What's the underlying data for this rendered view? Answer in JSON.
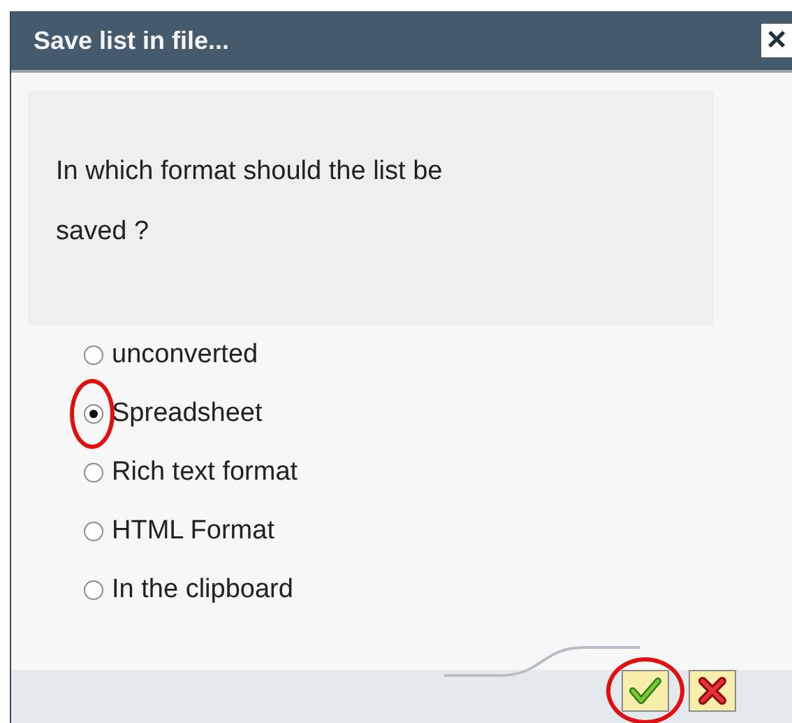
{
  "window": {
    "title": "Save list in file...",
    "close": "×"
  },
  "question": "In which format should the list be saved ?",
  "options": [
    {
      "label": "unconverted",
      "selected": false,
      "highlighted": false
    },
    {
      "label": "Spreadsheet",
      "selected": true,
      "highlighted": true
    },
    {
      "label": "Rich text format",
      "selected": false,
      "highlighted": false
    },
    {
      "label": "HTML Format",
      "selected": false,
      "highlighted": false
    },
    {
      "label": "In the clipboard",
      "selected": false,
      "highlighted": false
    }
  ],
  "buttons": [
    {
      "kind": "confirm",
      "highlighted": true
    },
    {
      "kind": "cancel",
      "highlighted": false
    }
  ]
}
